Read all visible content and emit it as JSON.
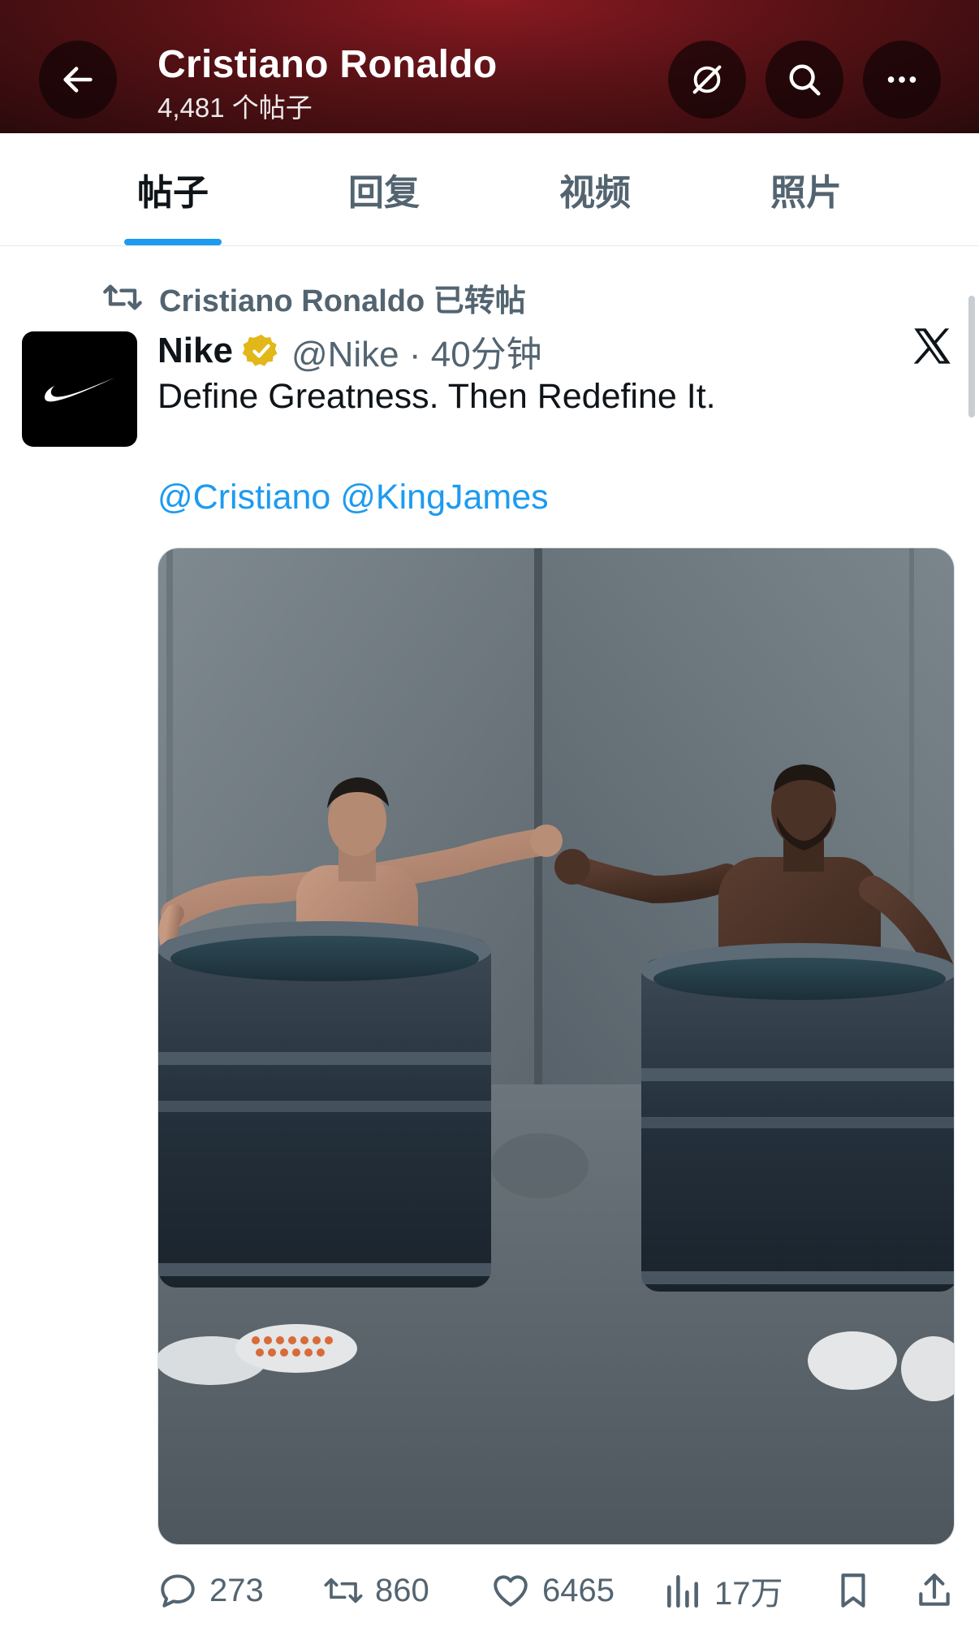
{
  "header": {
    "title": "Cristiano Ronaldo",
    "post_count": "4,481 个帖子",
    "icons": [
      "back-arrow-icon",
      "grok-icon",
      "search-icon",
      "more-icon"
    ]
  },
  "tabs": [
    {
      "label": "帖子",
      "active": true
    },
    {
      "label": "回复",
      "active": false
    },
    {
      "label": "视频",
      "active": false
    },
    {
      "label": "照片",
      "active": false
    }
  ],
  "post": {
    "repost_label": "Cristiano Ronaldo 已转帖",
    "author_name": "Nike",
    "handle_time": "@Nike · 40分钟",
    "text": "Define Greatness. Then Redefine It.",
    "mentions": [
      "@Cristiano",
      "@KingJames"
    ],
    "image_alt": "Cristiano Ronaldo and LeBron James fist-bumping from two ice-bath tubs",
    "stats": {
      "replies": "273",
      "reposts": "860",
      "likes": "6465",
      "views": "17万"
    }
  },
  "colors": {
    "accent": "#1d9bf0",
    "header_red": "#8a1a22",
    "verified_gold": "#e2b719",
    "muted_text": "#536471"
  }
}
